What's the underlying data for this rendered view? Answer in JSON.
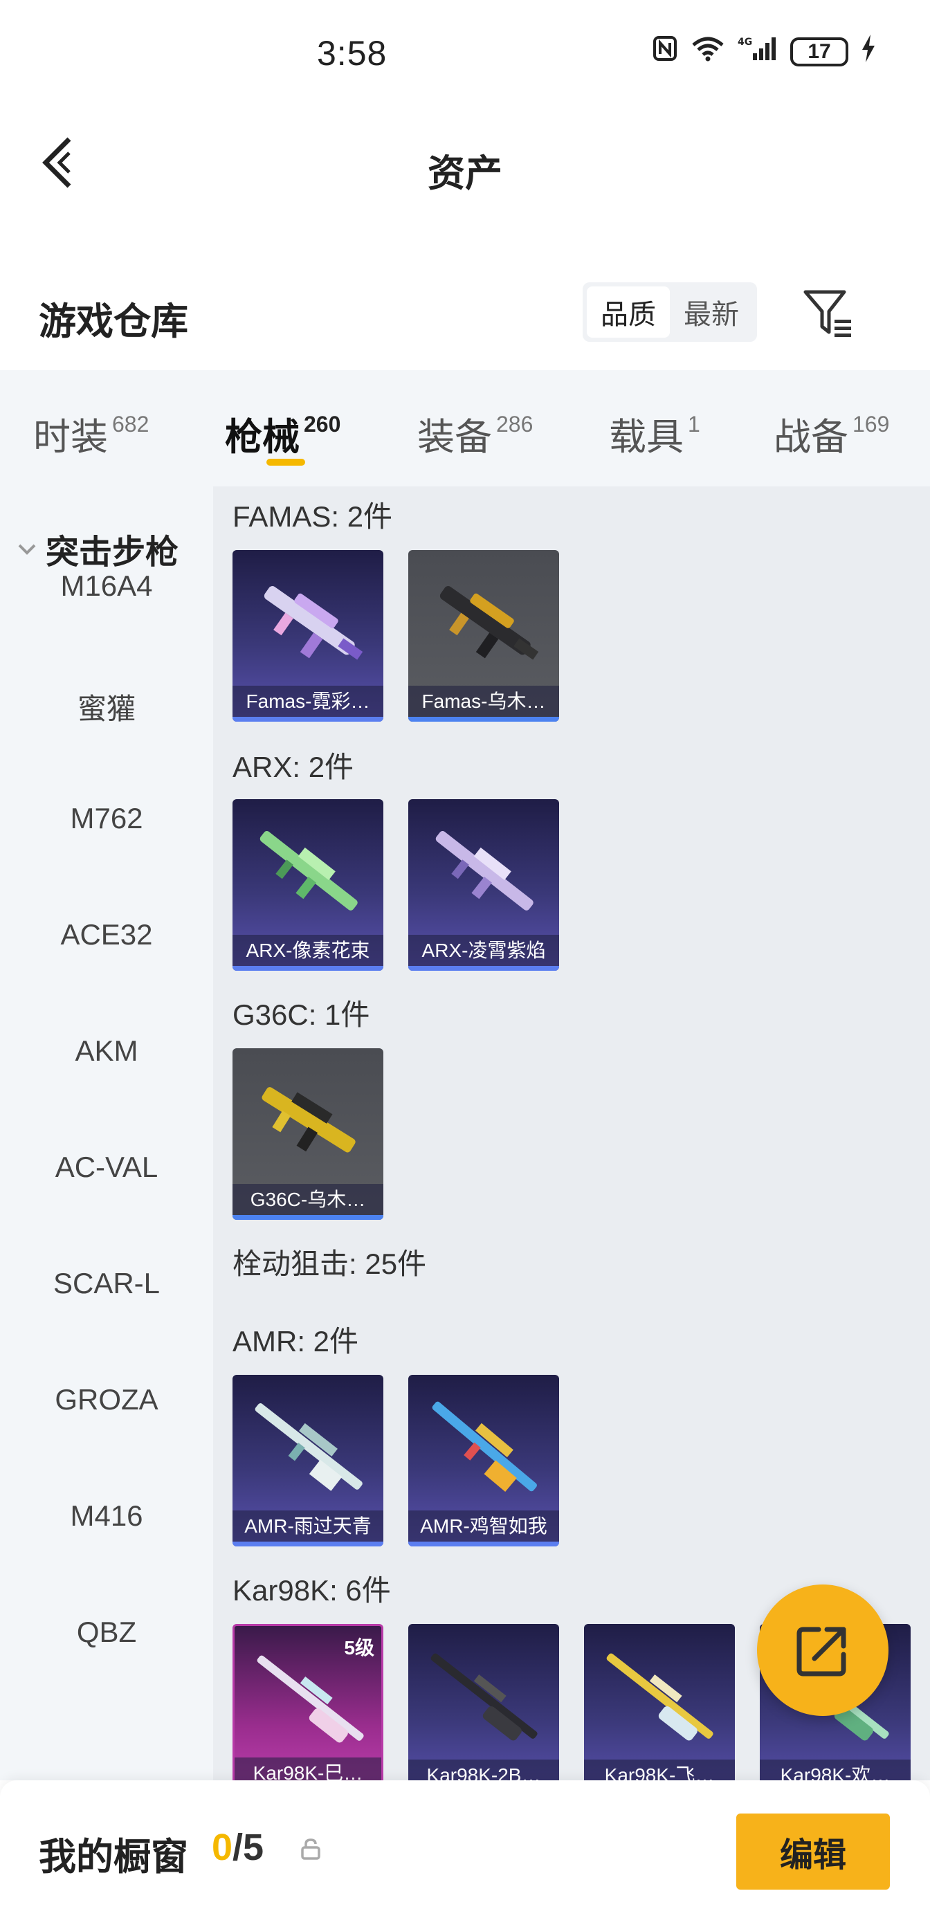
{
  "status_bar": {
    "time": "3:58",
    "battery": "17",
    "network": "4G"
  },
  "header": {
    "title": "资产"
  },
  "warehouse": {
    "title": "游戏仓库",
    "sort_options": [
      "品质",
      "最新"
    ]
  },
  "tabs": [
    {
      "label": "时装",
      "count": "682"
    },
    {
      "label": "枪械",
      "count": "260"
    },
    {
      "label": "装备",
      "count": "286"
    },
    {
      "label": "载具",
      "count": "1"
    },
    {
      "label": "战备",
      "count": "169"
    }
  ],
  "sidebar": {
    "category": "突击步枪",
    "items": [
      "M16A4",
      "蜜獾",
      "M762",
      "ACE32",
      "AKM",
      "AC-VAL",
      "SCAR-L",
      "GROZA",
      "M416",
      "QBZ"
    ]
  },
  "sections": {
    "famas": {
      "title": "FAMAS: 2件",
      "items": [
        "Famas-霓彩…",
        "Famas-乌木…"
      ]
    },
    "arx": {
      "title": "ARX: 2件",
      "items": [
        "ARX-像素花束",
        "ARX-凌霄紫焰"
      ]
    },
    "g36c": {
      "title": "G36C: 1件",
      "items": [
        "G36C-乌木…"
      ]
    },
    "sniper": {
      "title": "栓动狙击: 25件"
    },
    "amr": {
      "title": "AMR: 2件",
      "items": [
        "AMR-雨过天青",
        "AMR-鸡智如我"
      ]
    },
    "kar98k": {
      "title": "Kar98K: 6件",
      "items": [
        "Kar98K-巳…",
        "Kar98K-2B…",
        "Kar98K-飞…",
        "Kar98K-欢…"
      ],
      "level": "5级"
    }
  },
  "bottom": {
    "title": "我的橱窗",
    "current": "0",
    "total": "/5",
    "edit_label": "编辑"
  },
  "colors": {
    "accent": "#f7b21a",
    "tab_underline": "#f5b800",
    "card_purple": "#3a3878",
    "card_grey": "#5b5d62"
  }
}
